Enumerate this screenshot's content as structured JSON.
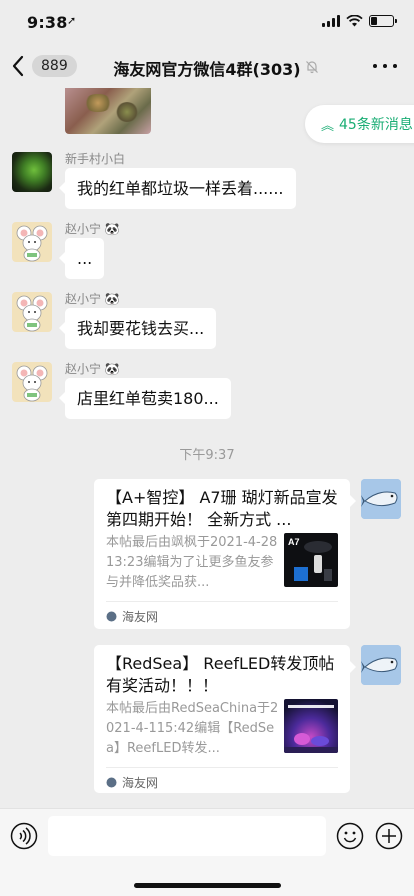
{
  "status_bar": {
    "time": "9:38",
    "location_glyph": "➚",
    "battery_level": 0.3
  },
  "nav": {
    "unread_count": "889",
    "title": "海友网官方微信4群(303)"
  },
  "new_messages": {
    "label": "45条新消息",
    "arrow": "︽"
  },
  "messages": [
    {
      "sender": "新手村小白",
      "text": "我的红单都垃圾一样丢着......"
    },
    {
      "sender": "赵小宁 🐼",
      "text": "..."
    },
    {
      "sender": "赵小宁 🐼",
      "text": "我却要花钱去买..."
    },
    {
      "sender": "赵小宁 🐼",
      "text": "店里红单苞卖180..."
    }
  ],
  "time_separator": "下午9:37",
  "link_cards": [
    {
      "title": "【A+智控】 A7珊 瑚灯新品宣发  第四期开始！ 全新方式  ...",
      "desc": "本帖最后由飒枫于2021-4-2813:23编辑为了让更多鱼友参与并降低奖品获...",
      "thumb_label": "A7",
      "source": "海友网"
    },
    {
      "title": "【RedSea】 ReefLED转发顶帖有奖活动！！！",
      "desc": "本帖最后由RedSeaChina于2021-4-115:42编辑【RedSea】ReefLED转发...",
      "source": "海友网"
    }
  ],
  "input": {
    "placeholder": ""
  },
  "colors": {
    "accent": "#1aad74",
    "background": "#ededed",
    "bubble": "#ffffff"
  }
}
